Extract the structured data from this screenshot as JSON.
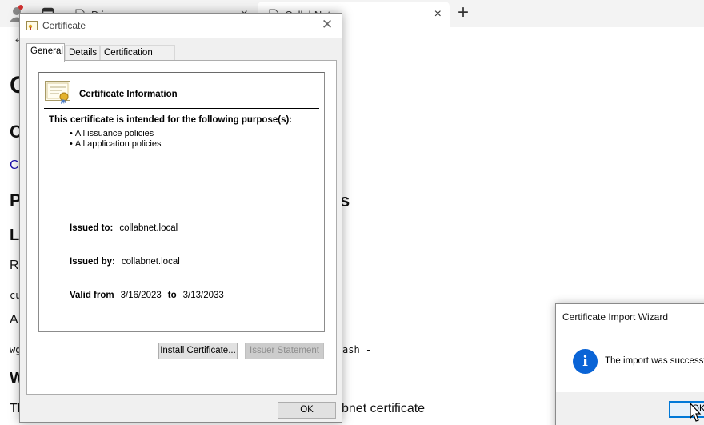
{
  "browser": {
    "tabs": [
      {
        "title": "Privacy error",
        "close": "×"
      },
      {
        "title": "CollabNet",
        "close": "×"
      }
    ],
    "new_tab": "+",
    "back": "←"
  },
  "background_page": {
    "fragments": [
      "C",
      "C",
      "C",
      "P",
      "s",
      "L",
      "R",
      "cu",
      "A",
      "wg",
      "ash -",
      "W",
      "Th",
      "bnet certificate"
    ]
  },
  "certificate_dialog": {
    "title": "Certificate",
    "close": "✕",
    "tabs": [
      "General",
      "Details",
      "Certification Path"
    ],
    "info_title": "Certificate Information",
    "purpose_heading": "This certificate is intended for the following purpose(s):",
    "purposes": [
      "All issuance policies",
      "All application policies"
    ],
    "issued_to_label": "Issued to:",
    "issued_to": "collabnet.local",
    "issued_by_label": "Issued by:",
    "issued_by": "collabnet.local",
    "valid_from_label": "Valid from",
    "valid_from": "3/16/2023",
    "to_label": "to",
    "valid_to": "3/13/2033",
    "install_button": "Install Certificate...",
    "issuer_statement_button": "Issuer Statement",
    "ok_button": "OK"
  },
  "import_wizard": {
    "title": "Certificate Import Wizard",
    "icon": "info-icon",
    "message": "The import was successf",
    "ok_button": "OK"
  },
  "colors": {
    "info_blue": "#0a64d6",
    "dialog_bg": "#f0f0f0",
    "focus_border": "#0078d7"
  }
}
